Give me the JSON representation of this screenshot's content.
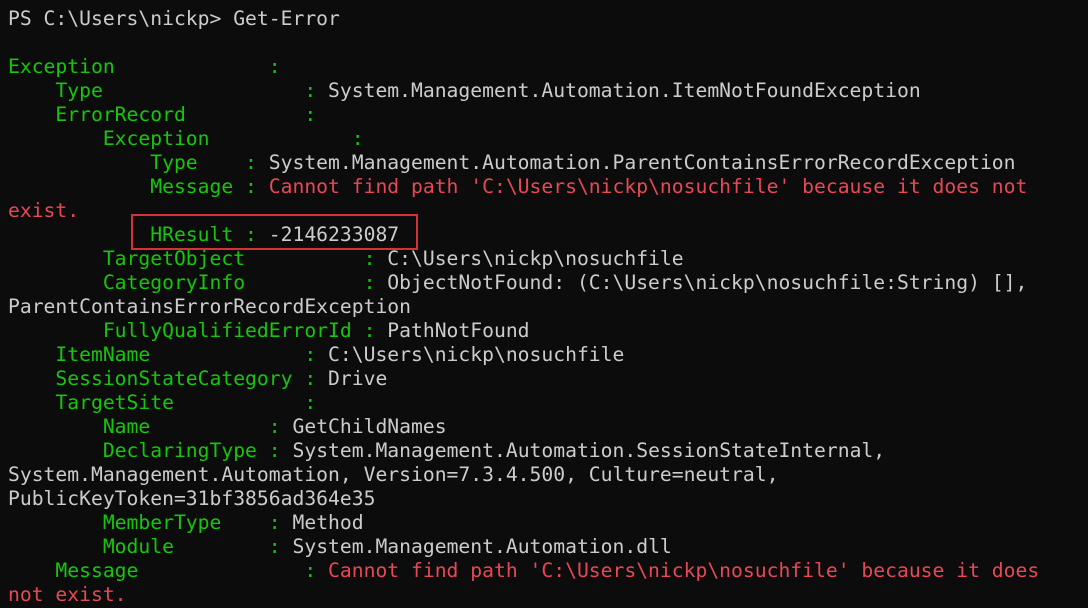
{
  "terminal": {
    "lines": [
      [
        {
          "t": "PS C:\\Users\\nickp> Get-Error",
          "c": "v"
        }
      ],
      [],
      [
        {
          "t": "Exception             :",
          "c": "k"
        }
      ],
      [
        {
          "t": "    Type                 : ",
          "c": "k"
        },
        {
          "t": "System.Management.Automation.ItemNotFoundException",
          "c": "v"
        }
      ],
      [
        {
          "t": "    ErrorRecord          :",
          "c": "k"
        }
      ],
      [
        {
          "t": "        Exception            :",
          "c": "k"
        }
      ],
      [
        {
          "t": "            Type    : ",
          "c": "k"
        },
        {
          "t": "System.Management.Automation.ParentContainsErrorRecordException",
          "c": "v"
        }
      ],
      [
        {
          "t": "            Message : ",
          "c": "k"
        },
        {
          "t": "Cannot find path 'C:\\Users\\nickp\\nosuchfile' because it does not",
          "c": "err"
        }
      ],
      [
        {
          "t": "exist.",
          "c": "err"
        }
      ],
      [
        {
          "t": "            HResult : ",
          "c": "k"
        },
        {
          "t": "-2146233087",
          "c": "v"
        }
      ],
      [
        {
          "t": "        TargetObject          : ",
          "c": "k"
        },
        {
          "t": "C:\\Users\\nickp\\nosuchfile",
          "c": "v"
        }
      ],
      [
        {
          "t": "        CategoryInfo          : ",
          "c": "k"
        },
        {
          "t": "ObjectNotFound: (C:\\Users\\nickp\\nosuchfile:String) [],",
          "c": "v"
        }
      ],
      [
        {
          "t": "ParentContainsErrorRecordException",
          "c": "v"
        }
      ],
      [
        {
          "t": "        FullyQualifiedErrorId : ",
          "c": "k"
        },
        {
          "t": "PathNotFound",
          "c": "v"
        }
      ],
      [
        {
          "t": "    ItemName             : ",
          "c": "k"
        },
        {
          "t": "C:\\Users\\nickp\\nosuchfile",
          "c": "v"
        }
      ],
      [
        {
          "t": "    SessionStateCategory : ",
          "c": "k"
        },
        {
          "t": "Drive",
          "c": "v"
        }
      ],
      [
        {
          "t": "    TargetSite           :",
          "c": "k"
        }
      ],
      [
        {
          "t": "        Name          : ",
          "c": "k"
        },
        {
          "t": "GetChildNames",
          "c": "v"
        }
      ],
      [
        {
          "t": "        DeclaringType : ",
          "c": "k"
        },
        {
          "t": "System.Management.Automation.SessionStateInternal,",
          "c": "v"
        }
      ],
      [
        {
          "t": "System.Management.Automation, Version=7.3.4.500, Culture=neutral,",
          "c": "v"
        }
      ],
      [
        {
          "t": "PublicKeyToken=31bf3856ad364e35",
          "c": "v"
        }
      ],
      [
        {
          "t": "        MemberType    : ",
          "c": "k"
        },
        {
          "t": "Method",
          "c": "v"
        }
      ],
      [
        {
          "t": "        Module        : ",
          "c": "k"
        },
        {
          "t": "System.Management.Automation.dll",
          "c": "v"
        }
      ],
      [
        {
          "t": "    Message              : ",
          "c": "k"
        },
        {
          "t": "Cannot find path 'C:\\Users\\nickp\\nosuchfile' because it does",
          "c": "err"
        }
      ],
      [
        {
          "t": "not exist.",
          "c": "err"
        }
      ]
    ],
    "highlight_line_index": 9
  }
}
